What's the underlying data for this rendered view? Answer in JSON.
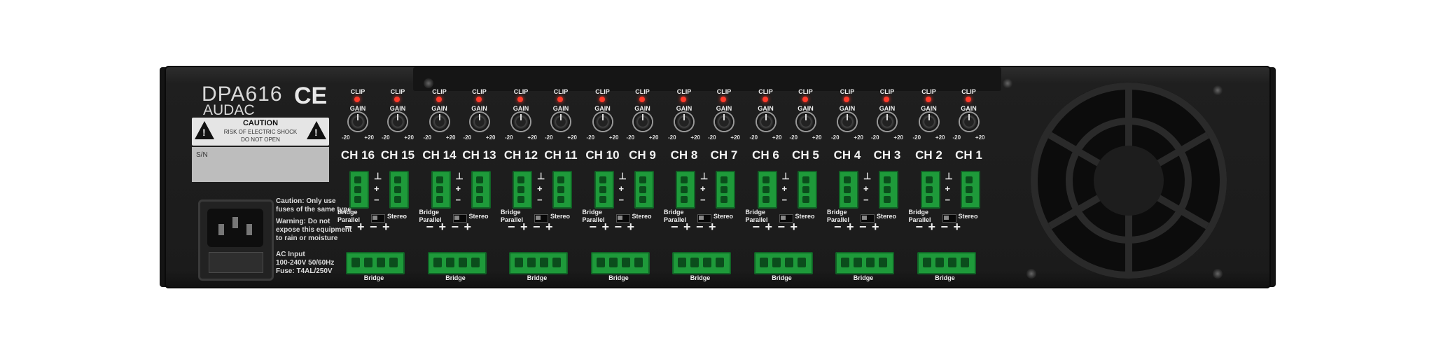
{
  "device": {
    "model": "DPA616",
    "brand": "AUDAC",
    "ce_mark": "CE",
    "caution": {
      "title": "CAUTION",
      "line1": "RISK OF ELECTRIC SHOCK",
      "line2": "DO NOT OPEN"
    },
    "serial_label": "S/N",
    "notes": {
      "fuse_caution": [
        "Caution: Only use",
        "fuses of the same type"
      ],
      "warning": [
        "Warning: Do not",
        "expose this equipment",
        "to rain or moisture"
      ],
      "ac_input": [
        "AC Input",
        "100-240V 50/60Hz",
        "Fuse: T4AL/250V"
      ]
    }
  },
  "channel_controls": {
    "clip_label": "CLIP",
    "gain_label": "GAIN",
    "gain_min": "-20",
    "gain_max": "+20"
  },
  "channels": [
    "CH 16",
    "CH 15",
    "CH 14",
    "CH 13",
    "CH 12",
    "CH 11",
    "CH 10",
    "CH 9",
    "CH 8",
    "CH 7",
    "CH 6",
    "CH 5",
    "CH 4",
    "CH 3",
    "CH 2",
    "CH 1"
  ],
  "pair_controls": {
    "bridge_label": "Bridge",
    "parallel_label": "Parallel",
    "stereo_label": "Stereo",
    "minus": "−",
    "plus": "+"
  },
  "bridge_terminal_label": "Bridge",
  "colors": {
    "chassis": "#1b1b1b",
    "terminal_green": "#1e9a3a",
    "led_red": "#ff3a2a",
    "label_panel": "#bdbdbd"
  }
}
